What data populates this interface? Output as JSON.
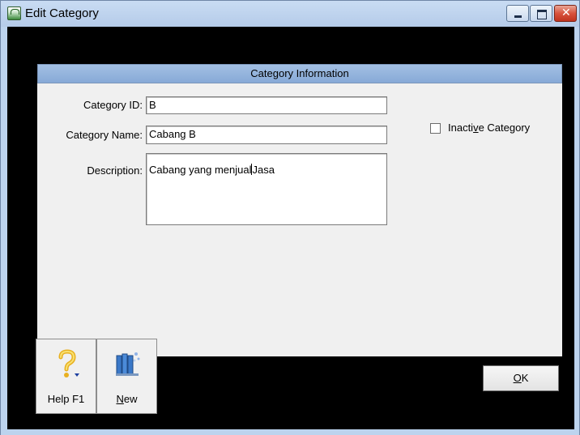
{
  "window": {
    "title": "Edit Category",
    "colors": {
      "frame": "#bcd3ee",
      "client_bg": "#000000",
      "panel_bg": "#f0f0f0",
      "header": "#9ab8e0",
      "close": "#d8533d"
    }
  },
  "panel": {
    "header": "Category Information",
    "fields": {
      "category_id": {
        "label": "Category ID:",
        "value": "B"
      },
      "category_name": {
        "label": "Category Name:",
        "value": "Cabang B"
      },
      "description": {
        "label": "Description:",
        "value_before_caret": "Cabang yang menjual",
        "value_after_caret": "Jasa"
      }
    },
    "inactive": {
      "label_pre": "Inacti",
      "label_accel": "v",
      "label_post": "e Category",
      "checked": false
    }
  },
  "toolbar": {
    "help": {
      "label": "Help F1",
      "icon": "help-question-icon"
    },
    "new": {
      "label_accel": "N",
      "label_rest": "ew",
      "icon": "new-books-icon"
    },
    "ok": {
      "label_accel": "O",
      "label_rest": "K"
    }
  }
}
